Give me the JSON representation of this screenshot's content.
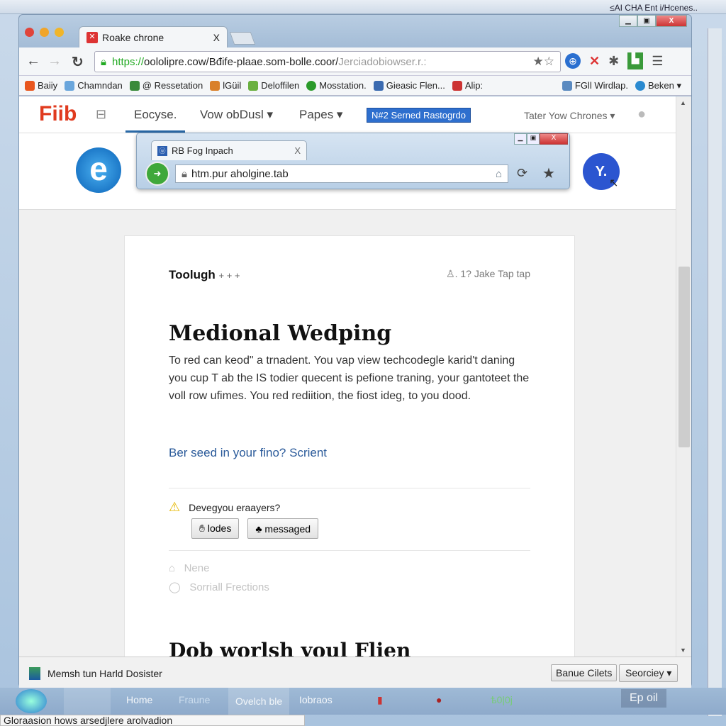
{
  "desktop": {
    "top_title": "≤AI CHA Ent i/Hcenes..",
    "tooltip": "Gloraasion hows arsedjlere arolvadion"
  },
  "browser": {
    "tab_title": "Roake chrone",
    "tab_close": "X",
    "url_secure": "https://",
    "url_main": "oololipre.cow/Bđife-plaae.som-bolle.coor/",
    "url_faded": "Jerciadobiowser.r.:",
    "bookmarks": [
      {
        "label": "Baiiy",
        "color": "#e8561e"
      },
      {
        "label": "Chamndan",
        "color": "#6aa6dc"
      },
      {
        "label": "@ Ressetation",
        "color": "#3a8a3a"
      },
      {
        "label": "lGüil",
        "color": "#d9802a"
      },
      {
        "label": "Deloffilen",
        "color": "#6ab040"
      },
      {
        "label": "Mosstation.",
        "color": "#2a9a2a"
      },
      {
        "label": "Gieasic Flen...",
        "color": "#3a6ab0"
      },
      {
        "label": "Alip:",
        "color": "#c33"
      }
    ],
    "bookmarks_right": [
      {
        "label": "FGll Wirdlap.",
        "color": "#5a8ac0"
      },
      {
        "label": "Beken ▾",
        "color": "#2a8ad0"
      }
    ]
  },
  "site": {
    "logo": "Fiib",
    "nav": [
      {
        "label": "Eocyse.",
        "active": true
      },
      {
        "label": "Vow obDusl ▾"
      },
      {
        "label": "Papes ▾"
      }
    ],
    "badge": "N#2 Serned Rastogrdo",
    "right_menu": "Tater Yow Chrones ▾",
    "yahoo_label": "Y."
  },
  "popup": {
    "tab_title": "RB Fog Inpach",
    "tab_close": "X",
    "url": "htm.pur aholgine.tab"
  },
  "article": {
    "kicker": "Toolugh",
    "kicker_marks": "+ + +",
    "meta": "♙. 1? Jake Tap tap",
    "title": "Medional Wedping",
    "body": "To red can keod\" a trnadent. You vap view techcodegle karid't daning you cup T ab the IS todier quecent is pefione traning, your gantoteet the voll row ufimes. You red rediition, the fiost ideg, to you dood.",
    "link": "Ber seed in your fino? Scrient",
    "warning": "Devegyou eraayers?",
    "buttons": [
      "lodes",
      "messaged"
    ],
    "faint_items": [
      "Nene",
      "Sorriall Frections"
    ],
    "subtitle": "Dob worlsh youl Flien"
  },
  "statusbar": {
    "text": "Memsh tun Harld Dosister",
    "button": "Banue Cilets",
    "select": "Seorciey ▾"
  },
  "taskbar": {
    "items": [
      "Home",
      "Fraune",
      "Ovelch ble",
      "Iobraos",
      "ѣ0|0j",
      "Ep oil"
    ]
  }
}
